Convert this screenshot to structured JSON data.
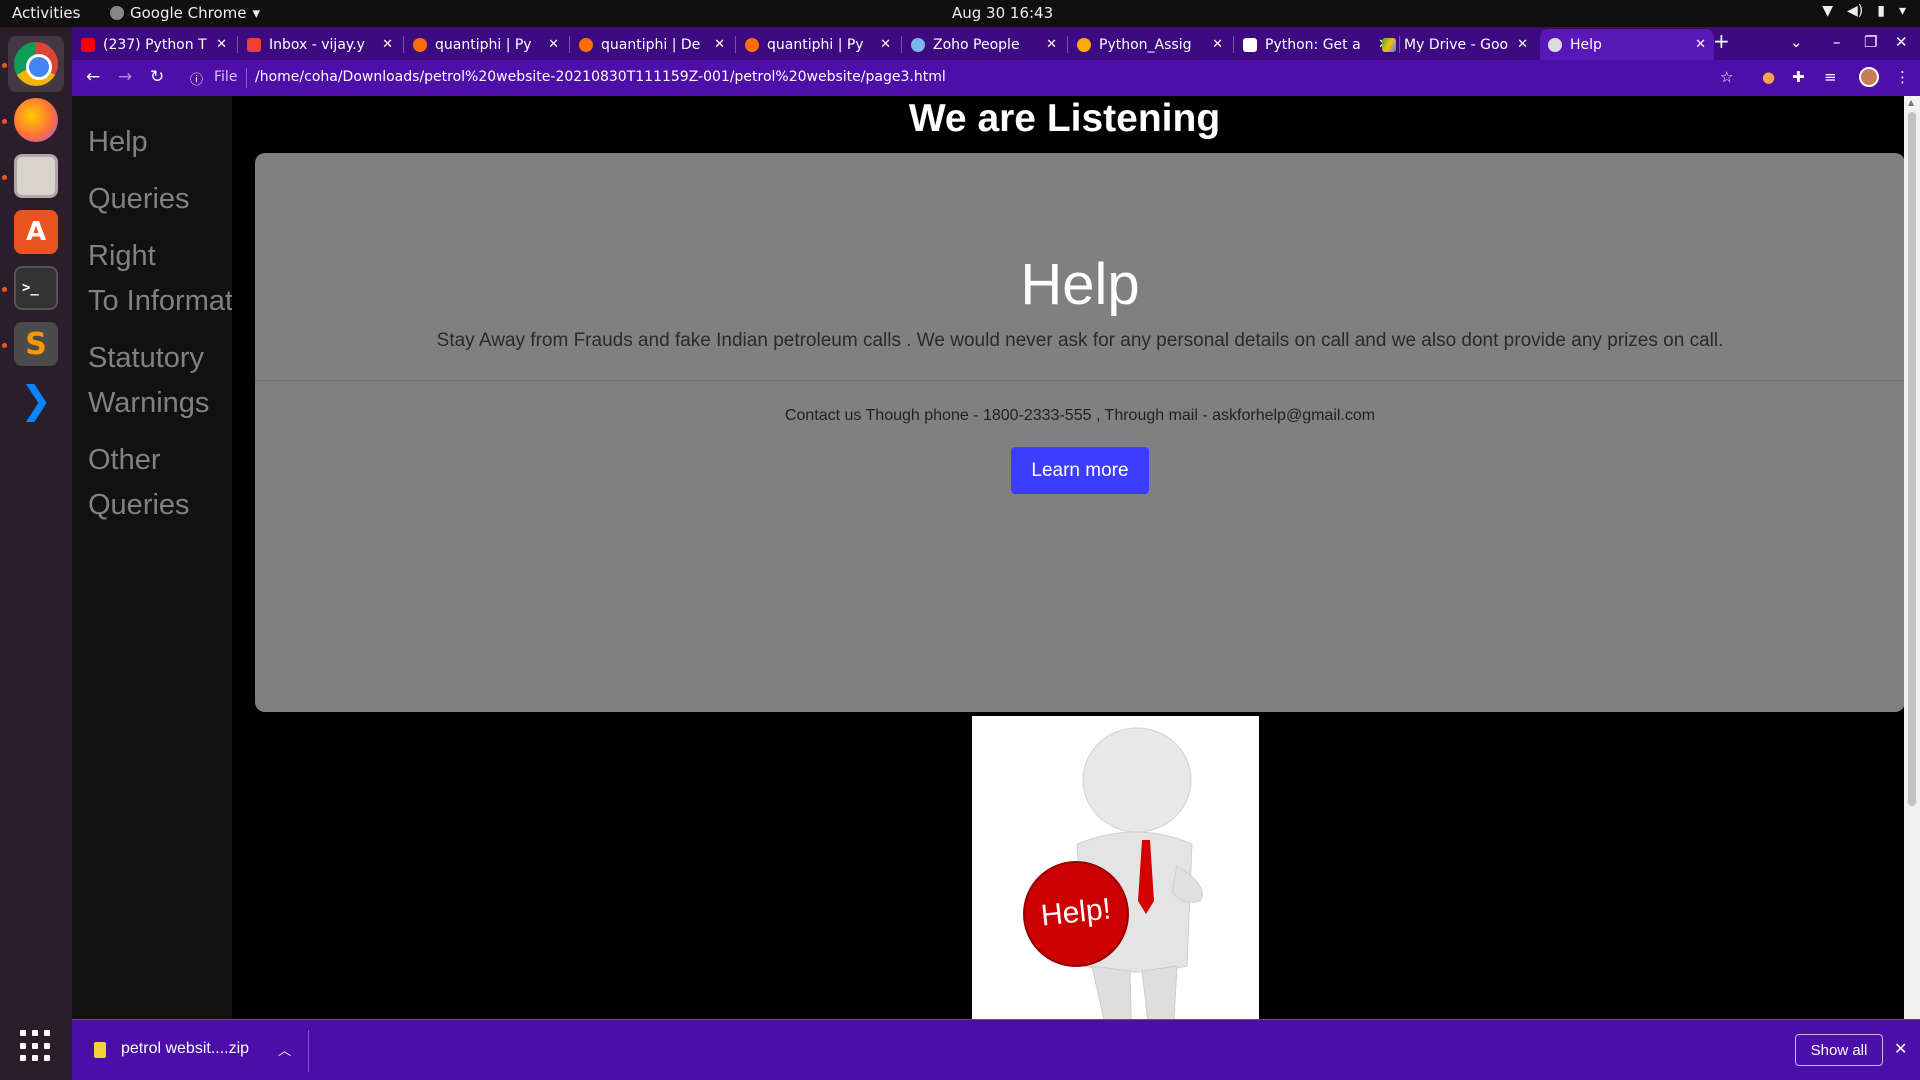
{
  "topbar": {
    "activities": "Activities",
    "app_name": "Google Chrome",
    "clock": "Aug 30  16:43"
  },
  "dock": {
    "apps": [
      "chrome-icon",
      "firefox-icon",
      "files-icon",
      "software-store-icon",
      "terminal-icon",
      "sublime-text-icon",
      "vscode-icon",
      "show-applications-icon"
    ]
  },
  "tabs": [
    {
      "label": "(237) Python T",
      "favicon": "youtube-icon",
      "color": "#ff0000"
    },
    {
      "label": "Inbox - vijay.y",
      "favicon": "gmail-icon",
      "color": "#ea4335"
    },
    {
      "label": "quantiphi | Py",
      "favicon": "quantiphi-icon",
      "color": "#ff6d00"
    },
    {
      "label": "quantiphi | De",
      "favicon": "quantiphi-icon",
      "color": "#ff6d00"
    },
    {
      "label": "quantiphi | Py",
      "favicon": "quantiphi-icon",
      "color": "#ff6d00"
    },
    {
      "label": "Zoho People",
      "favicon": "zoho-icon",
      "color": "#7cb4f0"
    },
    {
      "label": "Python_Assig",
      "favicon": "colab-icon",
      "color": "#f9ab00"
    },
    {
      "label": "Python: Get a",
      "favicon": "w3-icon",
      "color": "#ffffff"
    },
    {
      "label": "My Drive - Goo",
      "favicon": "drive-icon",
      "color": "#34a853"
    },
    {
      "label": "Help",
      "favicon": "globe-icon",
      "color": "#dcdcdc",
      "active": true
    }
  ],
  "address_bar": {
    "scheme": "File",
    "url": "/home/coha/Downloads/petrol%20website-20210830T111159Z-001/petrol%20website/page3.html"
  },
  "page": {
    "nav": [
      "Help",
      "Queries",
      "Right To Informatio",
      "Statutory Warnings",
      "Other Queries"
    ],
    "heading": "We are Listening",
    "jumbotron": {
      "title": "Help",
      "lead": "Stay Away from Frauds and fake Indian petroleum calls . We would never ask for any personal details on call and we also dont provide any prizes on call.",
      "contact": "Contact us Though phone - 1800-2333-555 , Through mail - askforhelp@gmail.com",
      "button": "Learn more"
    },
    "image": {
      "caption": "Help!"
    }
  },
  "download_bar": {
    "filename": "petrol websit....zip",
    "show_all": "Show all"
  },
  "colors": {
    "tabstrip": "#3d0a82",
    "toolbar": "#4d0fa8",
    "download_bar": "#4b0ea8",
    "jumbotron": "#808080",
    "button": "#3d3dff",
    "sidenav": "#111111",
    "nav_text": "#818181"
  }
}
